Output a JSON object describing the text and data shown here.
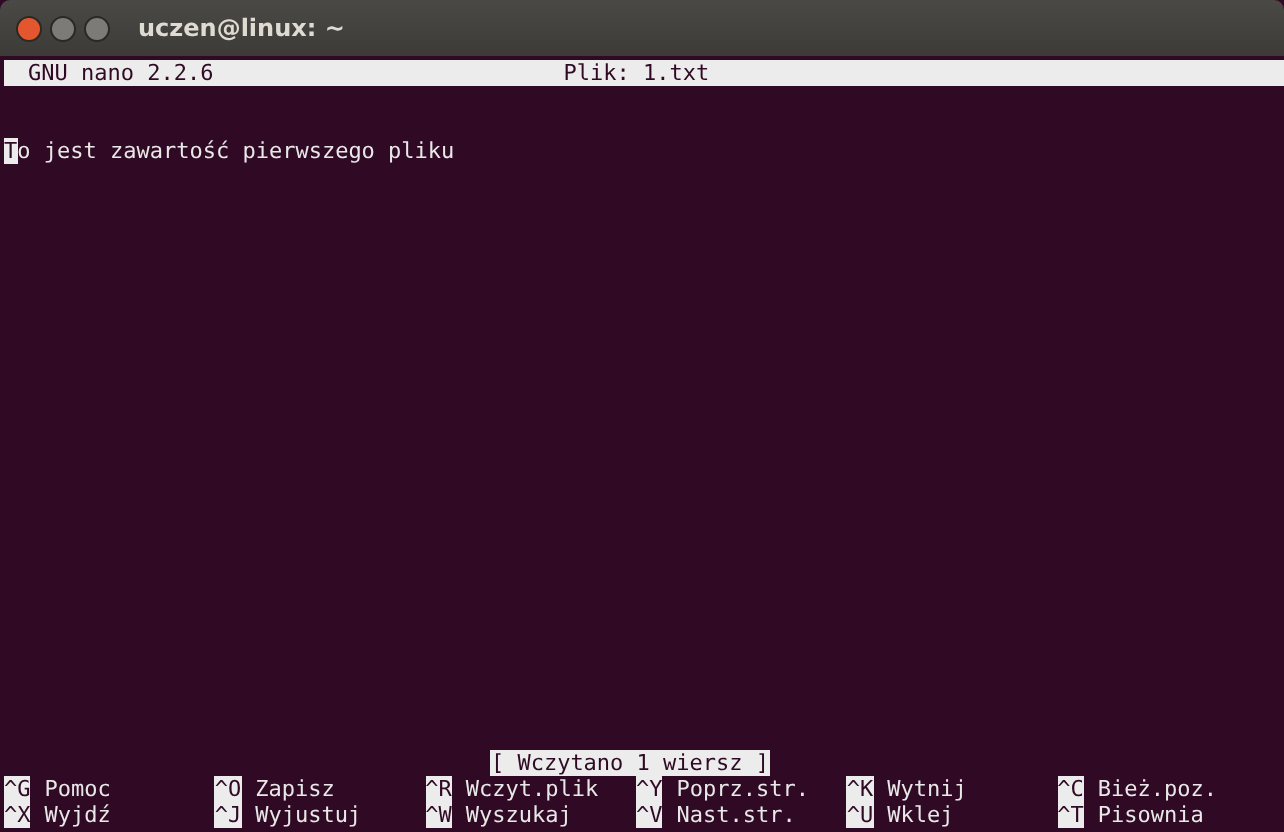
{
  "window": {
    "title": "uczen@linux: ~"
  },
  "header": {
    "program": "GNU nano 2.2.6",
    "file": "Plik: 1.txt"
  },
  "content": {
    "cursor_char": "T",
    "text": "o jest zawartość pierwszego pliku"
  },
  "status": "[ Wczytano 1 wiersz ]",
  "shortcuts": [
    {
      "key": "^G",
      "label": "Pomoc"
    },
    {
      "key": "^O",
      "label": "Zapisz"
    },
    {
      "key": "^R",
      "label": "Wczyt.plik"
    },
    {
      "key": "^Y",
      "label": "Poprz.str."
    },
    {
      "key": "^K",
      "label": "Wytnij"
    },
    {
      "key": "^C",
      "label": "Bież.poz."
    },
    {
      "key": "^X",
      "label": "Wyjdź"
    },
    {
      "key": "^J",
      "label": "Wyjustuj"
    },
    {
      "key": "^W",
      "label": "Wyszukaj"
    },
    {
      "key": "^V",
      "label": "Nast.str."
    },
    {
      "key": "^U",
      "label": "Wklej"
    },
    {
      "key": "^T",
      "label": "Pisownia"
    }
  ]
}
